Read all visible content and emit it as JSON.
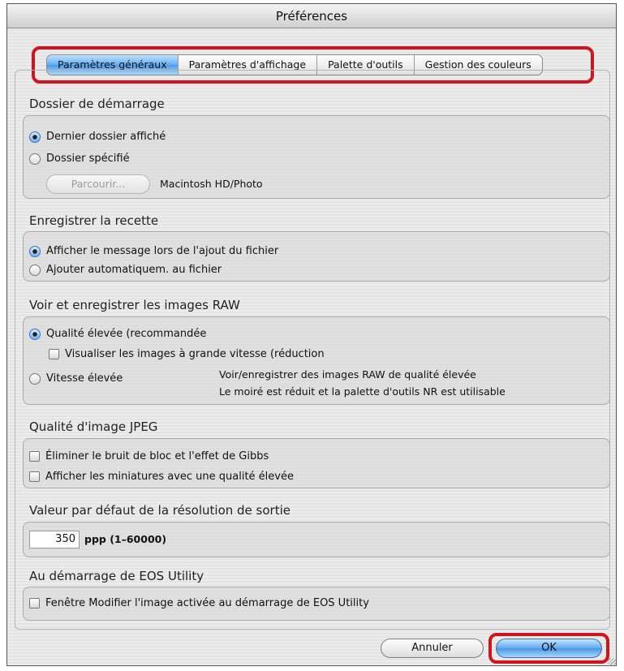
{
  "window": {
    "title": "Préférences"
  },
  "tabs": [
    {
      "label": "Paramètres généraux",
      "active": true
    },
    {
      "label": "Paramètres d'affichage",
      "active": false
    },
    {
      "label": "Palette d'outils",
      "active": false
    },
    {
      "label": "Gestion des couleurs",
      "active": false
    }
  ],
  "startup_folder": {
    "title": "Dossier de démarrage",
    "option_last": "Dernier dossier affiché",
    "option_specified": "Dossier spécifié",
    "selected": "last",
    "browse_label": "Parcourir...",
    "path": "Macintosh HD/Photo"
  },
  "recipe": {
    "title": "Enregistrer la recette",
    "option_show_message": "Afficher le message lors de l'ajout du fichier",
    "option_auto_add": "Ajouter automatiquem. au fichier",
    "selected": "show_message"
  },
  "raw": {
    "title": "Voir et enregistrer les images RAW",
    "option_high_quality": "Qualité élevée (recommandée",
    "checkbox_fast_view": "Visualiser les images à grande vitesse (réduction",
    "option_high_speed": "Vitesse élevée",
    "note_line1": "Voir/enregistrer des images RAW de qualité élevée",
    "note_line2": "Le moiré est réduit et la palette d'outils NR est utilisable",
    "selected": "high_quality"
  },
  "jpeg": {
    "title": "Qualité d'image JPEG",
    "checkbox_block_noise": "Éliminer le bruit de bloc et l'effet de Gibbs",
    "checkbox_thumbnails": "Afficher les miniatures avec une qualité élevée"
  },
  "resolution": {
    "title": "Valeur par défaut de la résolution de sortie",
    "value": "350",
    "unit": "ppp (1–60000)"
  },
  "eos_utility": {
    "title": "Au démarrage de EOS Utility",
    "checkbox_edit_window": "Fenêtre Modifier l'image activée au démarrage de EOS Utility"
  },
  "buttons": {
    "cancel": "Annuler",
    "ok": "OK"
  },
  "colors": {
    "highlight": "#d0141c",
    "accent_blue": "#4e9ae6"
  }
}
